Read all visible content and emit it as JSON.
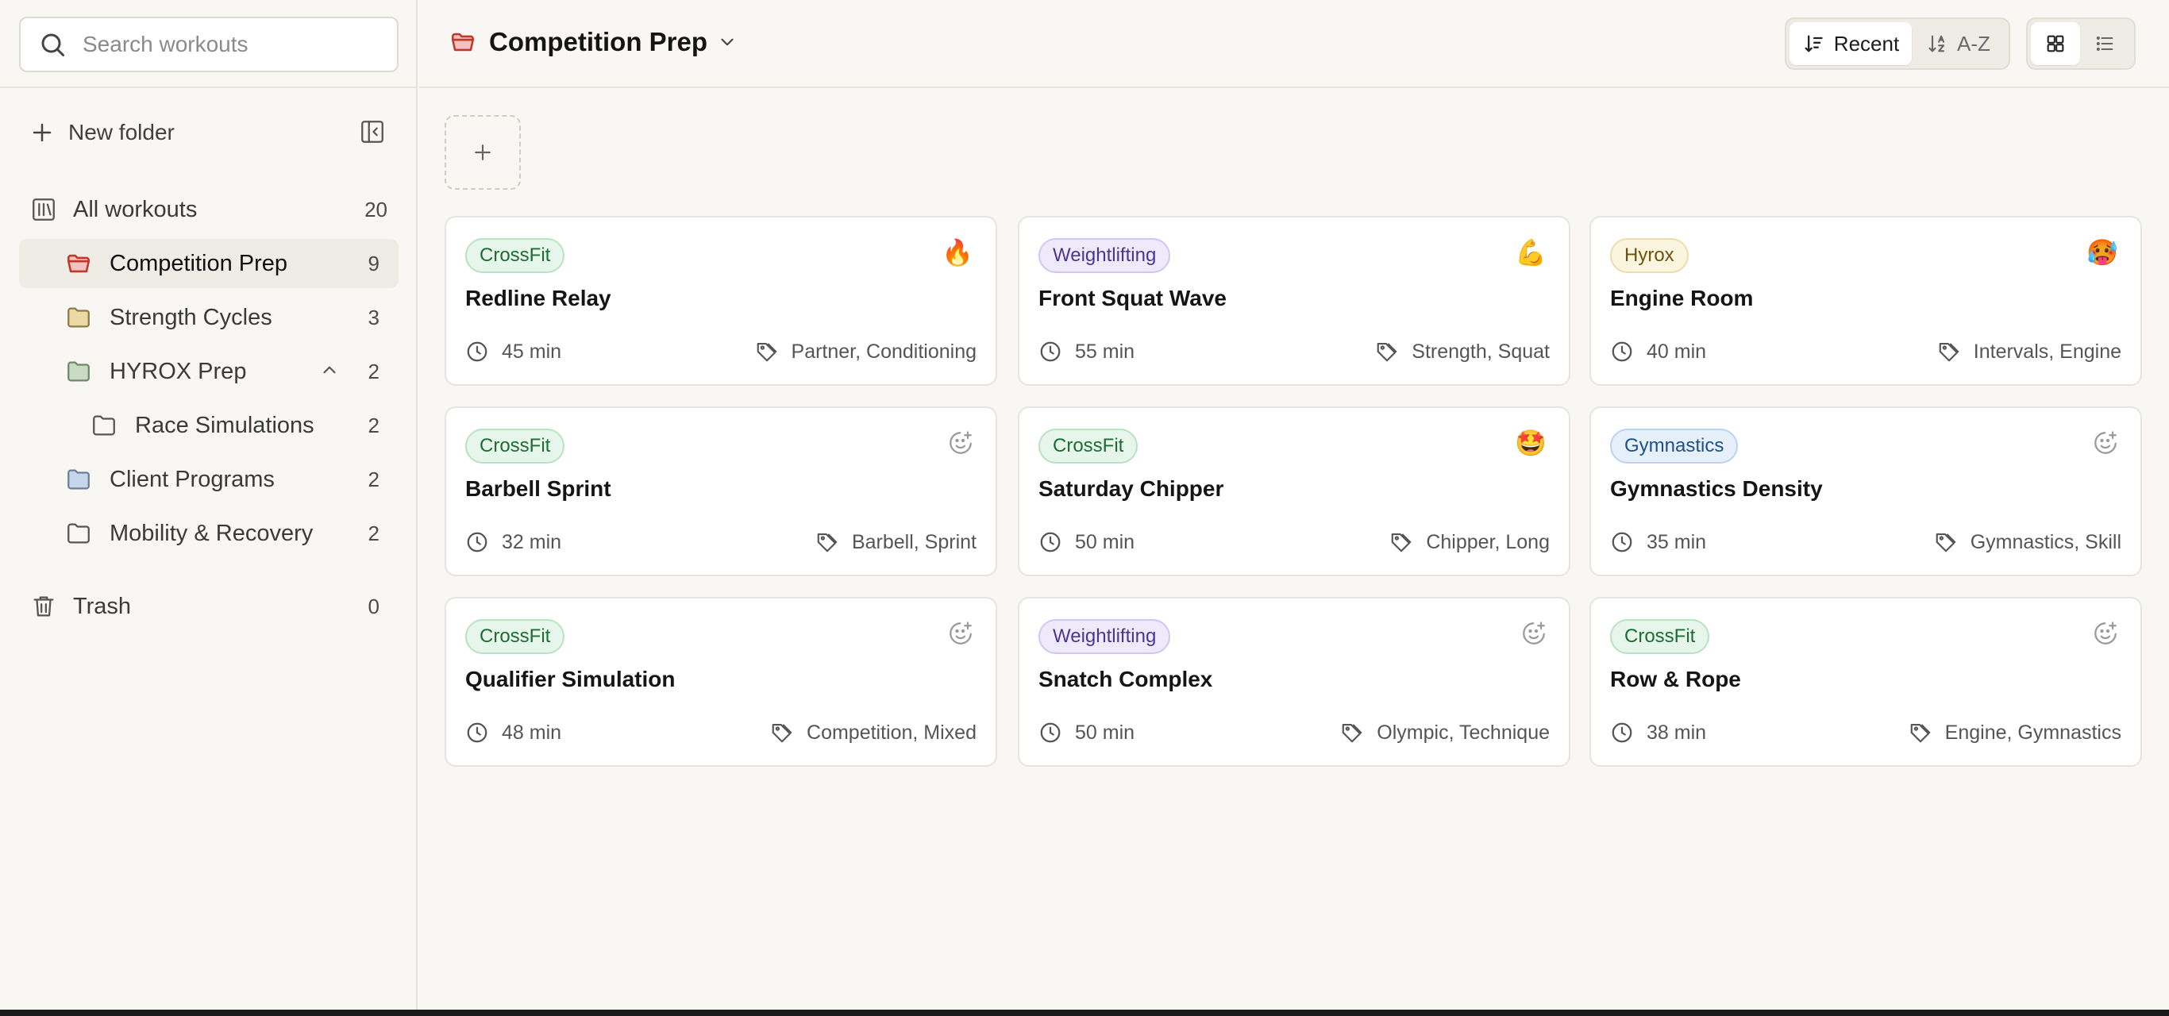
{
  "search": {
    "placeholder": "Search workouts"
  },
  "sidebar": {
    "new_folder_label": "New folder",
    "all": {
      "label": "All workouts",
      "count": "20"
    },
    "folders": [
      {
        "label": "Competition Prep",
        "count": "9",
        "color": "#f3c3c3",
        "active": true
      },
      {
        "label": "Strength Cycles",
        "count": "3",
        "color": "#ecd9a6"
      },
      {
        "label": "HYROX Prep",
        "count": "2",
        "color": "#c9dbc4",
        "expanded": true
      },
      {
        "label": "Race Simulations",
        "count": "2",
        "color": "none",
        "child": true
      },
      {
        "label": "Client Programs",
        "count": "2",
        "color": "#c7d6ea"
      },
      {
        "label": "Mobility & Recovery",
        "count": "2",
        "color": "none"
      }
    ],
    "trash": {
      "label": "Trash",
      "count": "0"
    }
  },
  "header": {
    "title": "Competition Prep",
    "sort": {
      "recent": "Recent",
      "az": "A-Z",
      "selected": "Recent"
    },
    "view": {
      "selected": "grid"
    }
  },
  "cards": [
    {
      "tag": "CrossFit",
      "emoji": "🔥",
      "name": "Redline Relay",
      "duration": "45 min",
      "labels": "Partner, Conditioning"
    },
    {
      "tag": "Weightlifting",
      "emoji": "💪",
      "name": "Front Squat Wave",
      "duration": "55 min",
      "labels": "Strength, Squat"
    },
    {
      "tag": "Hyrox",
      "emoji": "🥵",
      "name": "Engine Room",
      "duration": "40 min",
      "labels": "Intervals, Engine"
    },
    {
      "tag": "CrossFit",
      "emoji": "",
      "name": "Barbell Sprint",
      "duration": "32 min",
      "labels": "Barbell, Sprint"
    },
    {
      "tag": "CrossFit",
      "emoji": "🤩",
      "name": "Saturday Chipper",
      "duration": "50 min",
      "labels": "Chipper, Long"
    },
    {
      "tag": "Gymnastics",
      "emoji": "",
      "name": "Gymnastics Density",
      "duration": "35 min",
      "labels": "Gymnastics, Skill"
    },
    {
      "tag": "CrossFit",
      "emoji": "",
      "name": "Qualifier Simulation",
      "duration": "48 min",
      "labels": "Competition, Mixed"
    },
    {
      "tag": "Weightlifting",
      "emoji": "",
      "name": "Snatch Complex",
      "duration": "50 min",
      "labels": "Olympic, Technique"
    },
    {
      "tag": "CrossFit",
      "emoji": "",
      "name": "Row & Rope",
      "duration": "38 min",
      "labels": "Engine, Gymnastics"
    }
  ],
  "tag_colors": {
    "CrossFit": {
      "bg": "#e7f6ea",
      "border": "#b9e2c1",
      "text": "#1f6b34"
    },
    "Weightlifting": {
      "bg": "#efeafb",
      "border": "#d2c6f1",
      "text": "#4b3591"
    },
    "Hyrox": {
      "bg": "#fbf4df",
      "border": "#efdcaa",
      "text": "#6b5210"
    },
    "Gymnastics": {
      "bg": "#e6f0fb",
      "border": "#bcd3ef",
      "text": "#1f4f86"
    }
  }
}
